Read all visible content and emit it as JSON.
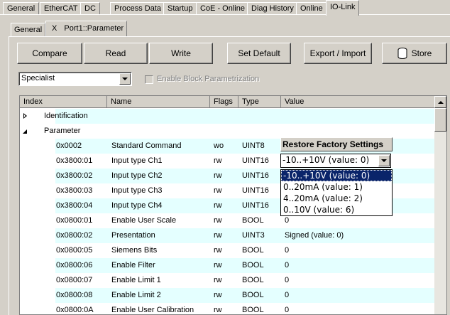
{
  "top_tabs": [
    "General",
    "EtherCAT",
    "DC",
    "Process Data",
    "Startup",
    "CoE - Online",
    "Diag History",
    "Online",
    "IO-Link"
  ],
  "inner_tabs": {
    "general": "General",
    "close_symbol": "X",
    "parameter": "Port1::Parameter"
  },
  "toolbar": {
    "compare": "Compare",
    "read": "Read",
    "write": "Write",
    "set_default": "Set Default",
    "export_import": "Export / Import",
    "store": "Store"
  },
  "access_level": {
    "selected": "Specialist"
  },
  "enable_block_label": "Enable Block Parametrization",
  "columns": [
    "Index",
    "Name",
    "Flags",
    "Type",
    "Value"
  ],
  "tree": {
    "identification": "Identification",
    "parameter": "Parameter"
  },
  "rows": [
    {
      "index": "0x0002",
      "name": "Standard Command",
      "flags": "wo",
      "type": "UINT8",
      "value": ""
    },
    {
      "index": "0x3800:01",
      "name": "Input type Ch1",
      "flags": "rw",
      "type": "UINT16",
      "value": ""
    },
    {
      "index": "0x3800:02",
      "name": "Input type Ch2",
      "flags": "rw",
      "type": "UINT16",
      "value": ""
    },
    {
      "index": "0x3800:03",
      "name": "Input type Ch3",
      "flags": "rw",
      "type": "UINT16",
      "value": ""
    },
    {
      "index": "0x3800:04",
      "name": "Input type Ch4",
      "flags": "rw",
      "type": "UINT16",
      "value": ""
    },
    {
      "index": "0x0800:01",
      "name": "Enable User Scale",
      "flags": "rw",
      "type": "BOOL",
      "value": "0"
    },
    {
      "index": "0x0800:02",
      "name": "Presentation",
      "flags": "rw",
      "type": "UINT3",
      "value": "Signed (value: 0)"
    },
    {
      "index": "0x0800:05",
      "name": "Siemens Bits",
      "flags": "rw",
      "type": "BOOL",
      "value": "0"
    },
    {
      "index": "0x0800:06",
      "name": "Enable Filter",
      "flags": "rw",
      "type": "BOOL",
      "value": "0"
    },
    {
      "index": "0x0800:07",
      "name": "Enable Limit 1",
      "flags": "rw",
      "type": "BOOL",
      "value": "0"
    },
    {
      "index": "0x0800:08",
      "name": "Enable Limit 2",
      "flags": "rw",
      "type": "BOOL",
      "value": "0"
    },
    {
      "index": "0x0800:0A",
      "name": "Enable User Calibration",
      "flags": "rw",
      "type": "BOOL",
      "value": "0"
    }
  ],
  "restore_button": "Restore Factory Settings",
  "value_combo": {
    "selected": "-10..+10V (value: 0)"
  },
  "dropdown_options": [
    "-10..+10V (value: 0)",
    "0..20mA (value: 1)",
    "4..20mA (value: 2)",
    "0..10V (value: 6)"
  ],
  "colors": {
    "row_shade": "#e4ffff",
    "selection": "#0a246a",
    "face": "#d4d0c8"
  },
  "icons": {
    "store": "database-icon",
    "expand": "triangle-right-icon",
    "collapse": "triangle-down-icon"
  }
}
